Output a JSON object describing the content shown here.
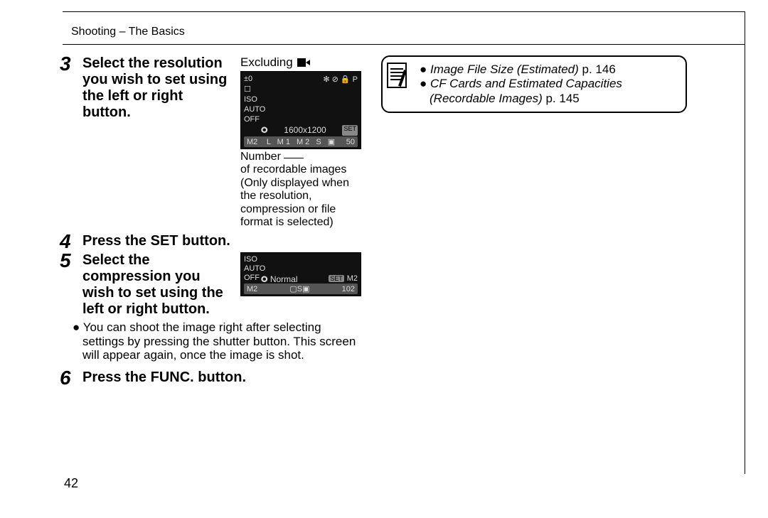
{
  "header": "Shooting – The Basics",
  "page_number": "42",
  "steps": {
    "s3": {
      "num": "3",
      "title": "Select the resolution you wish to set using the left or right button.",
      "excluding_label": "Excluding",
      "lcd": {
        "ev": "±0",
        "top_right": "✻ ⊘ 🔒 P",
        "left_icons": "☐\nISO\nAUTO\nOFF",
        "res_icon": "🞉",
        "res_text": "1600x1200",
        "set": "SET",
        "bar_left": "M2",
        "bar_opts": "L M1 M2 S ▣",
        "bar_right": "50"
      },
      "caption_word": "Number",
      "caption_rest": "of recordable images (Only displayed when the resolution, compression or file format is selected)"
    },
    "s4": {
      "num": "4",
      "title": "Press the SET button."
    },
    "s5": {
      "num": "5",
      "title": "Select the compression you wish to set using the left or right button.",
      "lcd": {
        "left_icons": "ISO\nAUTO\nOFF",
        "mid_icon": "🞉",
        "mid_text": "Normal",
        "set": "SET",
        "right_badge": "M2",
        "bar_left": "M2",
        "bar_mid": "▢S▣",
        "bar_right": "102"
      },
      "bullet": "You can shoot the image right after selecting settings by pressing the shutter button. This screen will appear again, once the image is shot."
    },
    "s6": {
      "num": "6",
      "title": "Press the FUNC. button."
    }
  },
  "notes": {
    "line1_text": "Image File Size (Estimated)",
    "line1_ref": " p. 146",
    "line2_text": "CF Cards and Estimated Capacities (Recordable Images)",
    "line2_ref": " p. 145"
  }
}
